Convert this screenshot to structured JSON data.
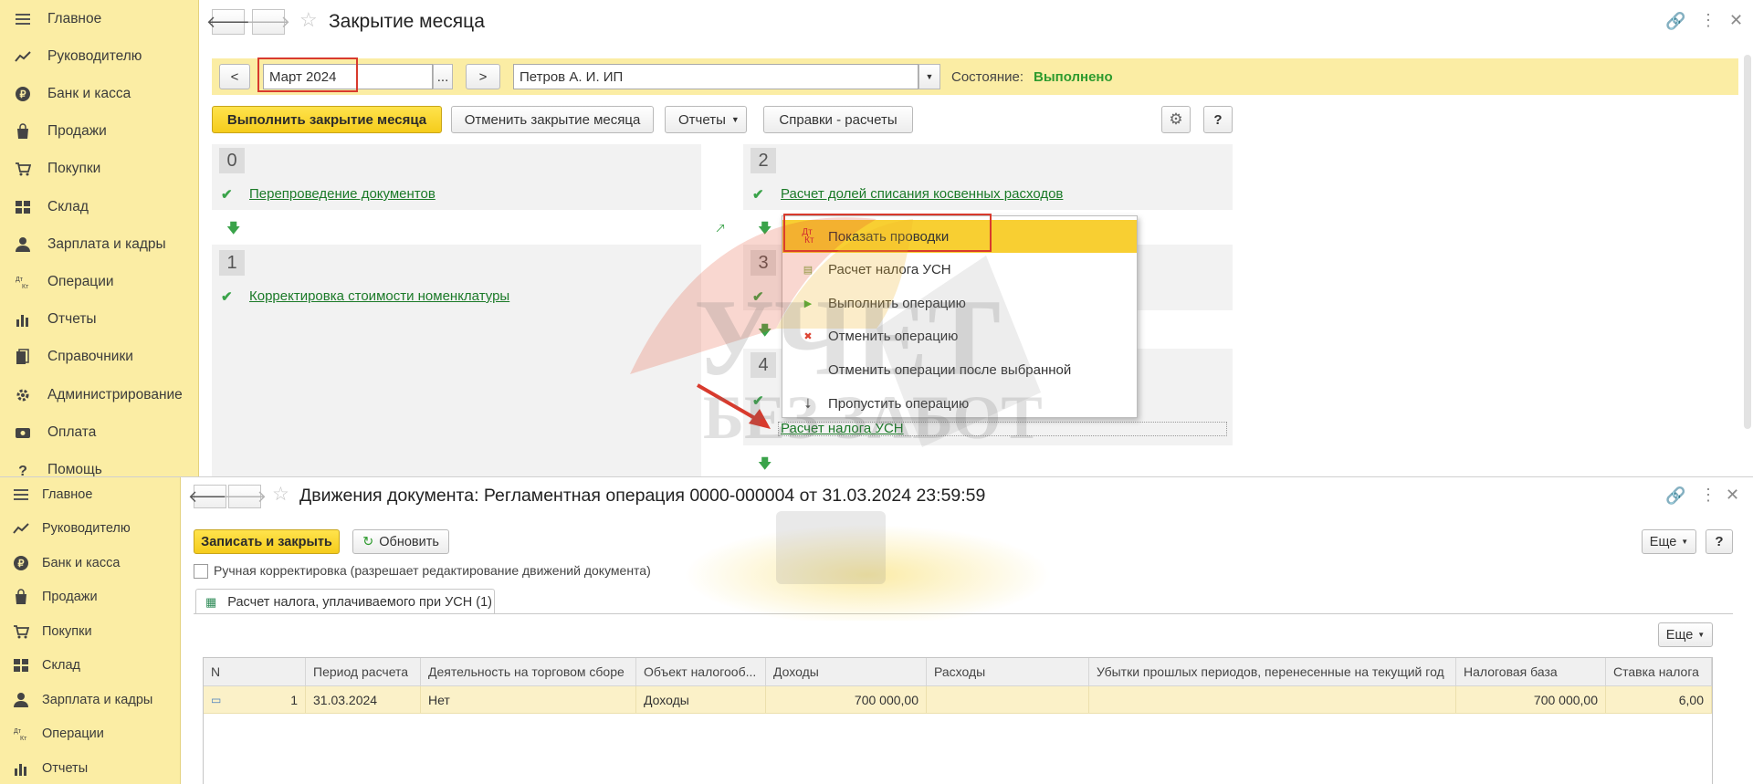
{
  "sidebar_top": [
    {
      "label": "Главное",
      "icon": "menu-icon"
    },
    {
      "label": "Руководителю",
      "icon": "trend-icon"
    },
    {
      "label": "Банк и касса",
      "icon": "coin-icon"
    },
    {
      "label": "Продажи",
      "icon": "bag-icon"
    },
    {
      "label": "Покупки",
      "icon": "cart-icon"
    },
    {
      "label": "Склад",
      "icon": "warehouse-icon"
    },
    {
      "label": "Зарплата и кадры",
      "icon": "person-icon"
    },
    {
      "label": "Операции",
      "icon": "dt-kt-icon"
    },
    {
      "label": "Отчеты",
      "icon": "barchart-icon"
    },
    {
      "label": "Справочники",
      "icon": "books-icon"
    },
    {
      "label": "Администрирование",
      "icon": "gear-icon"
    },
    {
      "label": "Оплата",
      "icon": "payment-icon"
    },
    {
      "label": "Помощь",
      "icon": "help-icon"
    }
  ],
  "top_window": {
    "title": "Закрытие месяца",
    "period": "Март 2024",
    "period_select": "...",
    "prev": "<",
    "next": ">",
    "organization": "Петров А. И. ИП",
    "state_label": "Состояние:",
    "state_value": "Выполнено",
    "buttons": {
      "close_month": "Выполнить закрытие месяца",
      "cancel_close": "Отменить закрытие месяца",
      "reports": "Отчеты",
      "references": "Справки - расчеты",
      "help": "?"
    },
    "steps": [
      {
        "num": "0",
        "links": [
          "Перепроведение документов"
        ]
      },
      {
        "num": "1",
        "links": [
          "Корректировка стоимости номенклатуры"
        ]
      },
      {
        "num": "2",
        "links": [
          "Расчет долей списания косвенных расходов"
        ]
      },
      {
        "num": "3",
        "links": []
      },
      {
        "num": "4",
        "links": [
          "Расчет налога УСН"
        ]
      }
    ],
    "context_menu": [
      {
        "label": "Показать проводки",
        "icon": "dt-kt-icon",
        "selected": true
      },
      {
        "label": "Расчет налога УСН",
        "icon": "report-icon"
      },
      {
        "label": "Выполнить операцию",
        "icon": "execute-icon"
      },
      {
        "label": "Отменить операцию",
        "icon": "cancel-op-icon"
      },
      {
        "label": "Отменить операции после выбранной",
        "icon": ""
      },
      {
        "label": "Пропустить операцию",
        "icon": "skip-icon"
      }
    ]
  },
  "sidebar_bottom": [
    {
      "label": "Главное",
      "icon": "menu-icon"
    },
    {
      "label": "Руководителю",
      "icon": "trend-icon"
    },
    {
      "label": "Банк и касса",
      "icon": "coin-icon"
    },
    {
      "label": "Продажи",
      "icon": "bag-icon"
    },
    {
      "label": "Покупки",
      "icon": "cart-icon"
    },
    {
      "label": "Склад",
      "icon": "warehouse-icon"
    },
    {
      "label": "Зарплата и кадры",
      "icon": "person-icon"
    },
    {
      "label": "Операции",
      "icon": "dt-kt-icon"
    },
    {
      "label": "Отчеты",
      "icon": "barchart-icon"
    }
  ],
  "bottom_window": {
    "title": "Движения документа: Регламентная операция 0000-000004 от 31.03.2024 23:59:59",
    "buttons": {
      "save_close": "Записать и закрыть",
      "refresh": "Обновить",
      "more": "Еще",
      "help": "?"
    },
    "manual_edit": "Ручная корректировка (разрешает редактирование движений документа)",
    "tab": "Расчет налога, уплачиваемого при УСН (1)",
    "table": {
      "columns": [
        "N",
        "Период расчета",
        "Деятельность на торговом сборе",
        "Объект налогооб...",
        "Доходы",
        "Расходы",
        "Убытки прошлых периодов, перенесенные на текущий год",
        "Налоговая база",
        "Ставка налога"
      ],
      "rows": [
        [
          "1",
          "31.03.2024",
          "Нет",
          "Доходы",
          "700 000,00",
          "",
          "",
          "700 000,00",
          "6,00"
        ]
      ]
    }
  },
  "watermark": {
    "line1": "УЧЕТ",
    "line2": "БЕЗ ЗАБОТ"
  },
  "colors": {
    "accent_yellow": "#f8cf32",
    "sidebar": "#fbeda4",
    "link_green": "#1b7a28",
    "state_green": "#2e9b2e",
    "highlight_red": "#d83a2d"
  }
}
